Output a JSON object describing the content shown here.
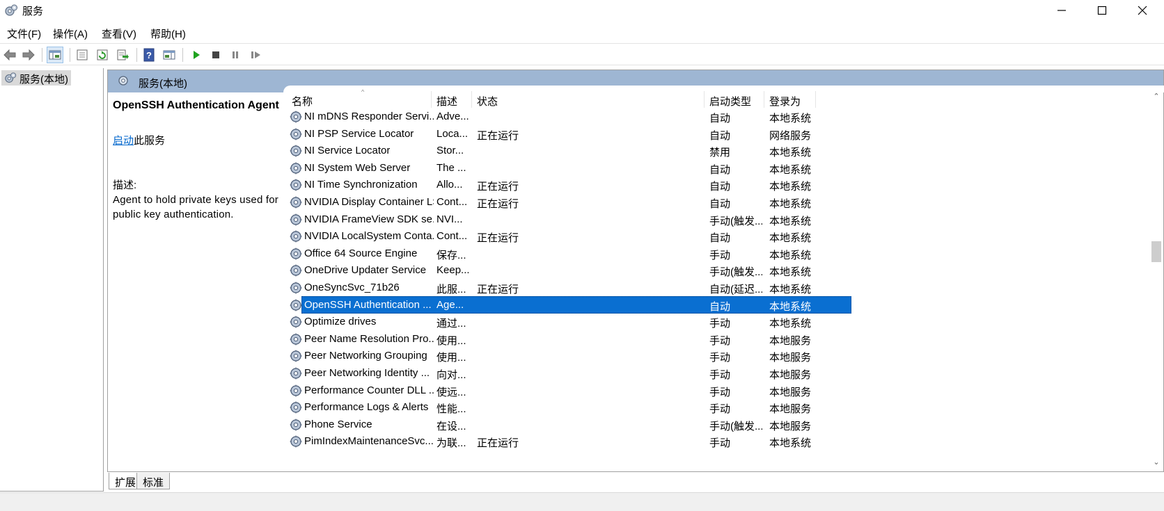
{
  "window": {
    "title": "服务"
  },
  "menu": {
    "items": [
      "文件(F)",
      "操作(A)",
      "查看(V)",
      "帮助(H)"
    ]
  },
  "toolbar": {
    "buttons": [
      "back-icon",
      "forward-icon",
      "show-hide-console-tree-icon",
      "properties-icon",
      "refresh-icon",
      "export-list-icon",
      "help-icon",
      "show-hide-action-pane-icon",
      "start-service-icon",
      "stop-service-icon",
      "pause-service-icon",
      "resume-service-icon"
    ]
  },
  "tree": {
    "root_label": "服务(本地)"
  },
  "pane": {
    "header": "服务(本地)",
    "selected_title": "OpenSSH Authentication Agent",
    "action_link": "启动",
    "action_suffix": "此服务",
    "desc_label": "描述:",
    "desc_text": "Agent to hold private keys used for public key authentication."
  },
  "columns": {
    "name": "名称",
    "desc": "描述",
    "status": "状态",
    "startup": "启动类型",
    "logon": "登录为"
  },
  "rows": [
    {
      "name": "NI mDNS Responder Servi...",
      "desc": "Adve...",
      "status": "",
      "startup": "自动",
      "logon": "本地系统"
    },
    {
      "name": "NI PSP Service Locator",
      "desc": "Loca...",
      "status": "正在运行",
      "startup": "自动",
      "logon": "网络服务"
    },
    {
      "name": "NI Service Locator",
      "desc": "Stor...",
      "status": "",
      "startup": "禁用",
      "logon": "本地系统"
    },
    {
      "name": "NI System Web Server",
      "desc": "The ...",
      "status": "",
      "startup": "自动",
      "logon": "本地系统"
    },
    {
      "name": "NI Time Synchronization",
      "desc": "Allo...",
      "status": "正在运行",
      "startup": "自动",
      "logon": "本地系统"
    },
    {
      "name": "NVIDIA Display Container LS",
      "desc": "Cont...",
      "status": "正在运行",
      "startup": "自动",
      "logon": "本地系统"
    },
    {
      "name": "NVIDIA FrameView SDK se...",
      "desc": "NVI...",
      "status": "",
      "startup": "手动(触发...",
      "logon": "本地系统"
    },
    {
      "name": "NVIDIA LocalSystem Conta...",
      "desc": "Cont...",
      "status": "正在运行",
      "startup": "自动",
      "logon": "本地系统"
    },
    {
      "name": "Office 64 Source Engine",
      "desc": "保存...",
      "status": "",
      "startup": "手动",
      "logon": "本地系统"
    },
    {
      "name": "OneDrive Updater Service",
      "desc": "Keep...",
      "status": "",
      "startup": "手动(触发...",
      "logon": "本地系统"
    },
    {
      "name": "OneSyncSvc_71b26",
      "desc": "此服...",
      "status": "正在运行",
      "startup": "自动(延迟...",
      "logon": "本地系统"
    },
    {
      "name": "OpenSSH Authentication ...",
      "desc": "Age...",
      "status": "",
      "startup": "自动",
      "logon": "本地系统",
      "selected": true
    },
    {
      "name": "Optimize drives",
      "desc": "通过...",
      "status": "",
      "startup": "手动",
      "logon": "本地系统"
    },
    {
      "name": "Peer Name Resolution Pro...",
      "desc": "使用...",
      "status": "",
      "startup": "手动",
      "logon": "本地服务"
    },
    {
      "name": "Peer Networking Grouping",
      "desc": "使用...",
      "status": "",
      "startup": "手动",
      "logon": "本地服务"
    },
    {
      "name": "Peer Networking Identity ...",
      "desc": "向对...",
      "status": "",
      "startup": "手动",
      "logon": "本地服务"
    },
    {
      "name": "Performance Counter DLL ...",
      "desc": "使远...",
      "status": "",
      "startup": "手动",
      "logon": "本地服务"
    },
    {
      "name": "Performance Logs & Alerts",
      "desc": "性能...",
      "status": "",
      "startup": "手动",
      "logon": "本地服务"
    },
    {
      "name": "Phone Service",
      "desc": "在设...",
      "status": "",
      "startup": "手动(触发...",
      "logon": "本地服务"
    },
    {
      "name": "PimIndexMaintenanceSvc...",
      "desc": "为联...",
      "status": "正在运行",
      "startup": "手动",
      "logon": "本地系统"
    }
  ],
  "tabs": [
    "扩展",
    "标准"
  ],
  "colors": {
    "header_bg": "#9eb6d3",
    "selection": "#0a6fd1",
    "link": "#0066cc"
  }
}
